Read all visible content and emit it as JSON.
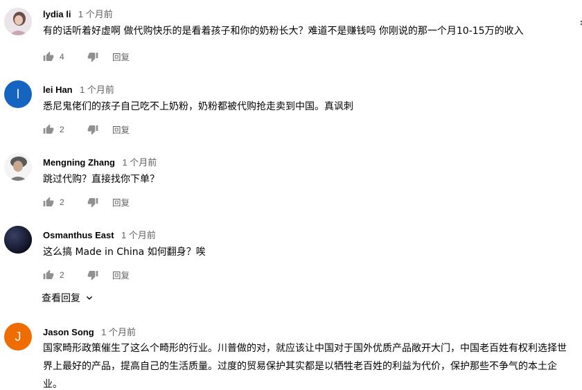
{
  "comments": [
    {
      "author": "lydia li",
      "time": "1 个月前",
      "text": "有的话听着好虚啊 做代购快乐的是看着孩子和你的奶粉长大？难道不是赚钱吗 你刚说的那一个月10-15万的收入",
      "likes": "4",
      "reply_label": "回复",
      "avatar": "photo",
      "avatar_color": "#d9c7cf"
    },
    {
      "author": "lei Han",
      "time": "1 个月前",
      "text": "悉尼鬼佬们的孩子自己吃不上奶粉，奶粉都被代购抢走卖到中国。真讽刺",
      "likes": "2",
      "reply_label": "回复",
      "avatar_letter": "l",
      "avatar_color": "#1565c0"
    },
    {
      "author": "Mengning Zhang",
      "time": "1 个月前",
      "text": "跳过代购？直接找你下单？",
      "likes": "2",
      "reply_label": "回复",
      "avatar": "photo",
      "avatar_color": "#9e9e9e"
    },
    {
      "author": "Osmanthus East",
      "time": "1 个月前",
      "text": "这么搞 Made in China 如何翻身？唉",
      "likes": "2",
      "reply_label": "回复",
      "avatar": "photo",
      "avatar_color": "#1b1f3a"
    },
    {
      "author": "Jason Song",
      "time": "1 个月前",
      "text": "国家畸形政策催生了这么个畸形的行业。川普做的对，就应该让中国对于国外优质产品敞开大门，中国老百姓有权利选择世界上最好的产品，提高自己的生活质量。过度的贸易保护其实都是以牺牲老百姓的利益为代价，保护那些不争气的本土企业。",
      "avatar_letter": "J",
      "avatar_color": "#ef6c00"
    }
  ],
  "view_replies_label": "查看回复",
  "icons": {
    "like": "thumb-up-icon",
    "dislike": "thumb-down-icon",
    "expand": "chevron-down-icon"
  }
}
